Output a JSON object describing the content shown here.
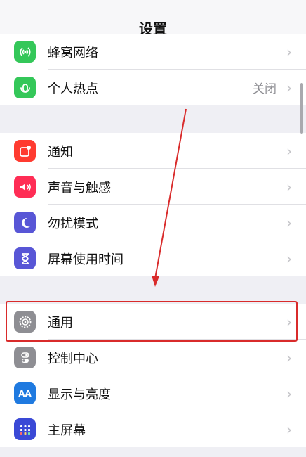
{
  "header": {
    "title": "设置"
  },
  "group1": [
    {
      "label": "蜂窝网络",
      "icon": "cellular-icon",
      "color": "#34c759"
    },
    {
      "label": "个人热点",
      "icon": "hotspot-icon",
      "color": "#34c759",
      "detail": "关闭"
    }
  ],
  "group2": [
    {
      "label": "通知",
      "icon": "notifications-icon",
      "color": "#ff3b30"
    },
    {
      "label": "声音与触感",
      "icon": "sound-icon",
      "color": "#ff2d55"
    },
    {
      "label": "勿扰模式",
      "icon": "moon-icon",
      "color": "#5856d6"
    },
    {
      "label": "屏幕使用时间",
      "icon": "hourglass-icon",
      "color": "#5856d6"
    }
  ],
  "group3": [
    {
      "label": "通用",
      "icon": "gear-icon",
      "color": "#8e8e93"
    },
    {
      "label": "控制中心",
      "icon": "toggles-icon",
      "color": "#8e8e93"
    },
    {
      "label": "显示与亮度",
      "icon": "text-size-icon",
      "color": "#1f7ae0",
      "icon_text": "AA"
    },
    {
      "label": "主屏幕",
      "icon": "home-grid-icon",
      "color": "#3a49d6"
    }
  ],
  "chevron": "›",
  "annotation": {
    "color": "#d92b2b"
  }
}
